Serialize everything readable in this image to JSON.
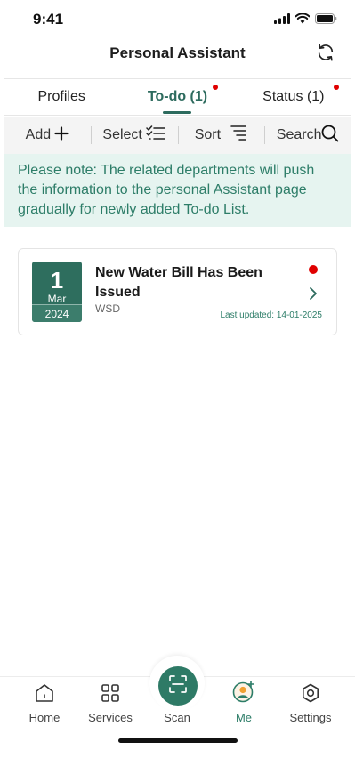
{
  "status_bar": {
    "time": "9:41"
  },
  "header": {
    "title": "Personal Assistant",
    "refresh_icon": "refresh-icon"
  },
  "tabs": [
    {
      "label": "Profiles",
      "active": false,
      "has_dot": false
    },
    {
      "label": "To-do (1)",
      "active": true,
      "has_dot": true
    },
    {
      "label": "Status (1)",
      "active": false,
      "has_dot": true
    }
  ],
  "toolbar": {
    "add_label": "Add",
    "select_label": "Select",
    "sort_label": "Sort",
    "search_label": "Search"
  },
  "notice": {
    "text": "Please note: The related departments will push the information to the personal Assistant page gradually for newly added To-do List."
  },
  "todo_items": [
    {
      "day": "1",
      "month": "Mar",
      "year": "2024",
      "title": "New Water Bill Has Been Issued",
      "source": "WSD",
      "last_updated": "Last updated: 14-01-2025",
      "unread": true
    }
  ],
  "bottom_nav": [
    {
      "label": "Home",
      "icon": "home-icon"
    },
    {
      "label": "Services",
      "icon": "grid-icon"
    },
    {
      "label": "Scan",
      "icon": "scan-icon"
    },
    {
      "label": "Me",
      "icon": "profile-icon",
      "active": true
    },
    {
      "label": "Settings",
      "icon": "settings-icon"
    }
  ],
  "colors": {
    "primary": "#2d6b5e",
    "notice_bg": "#e6f4f0",
    "notice_text": "#2d7d68",
    "badge_red": "#e00000",
    "toolbar_bg": "#f4f4f4"
  }
}
